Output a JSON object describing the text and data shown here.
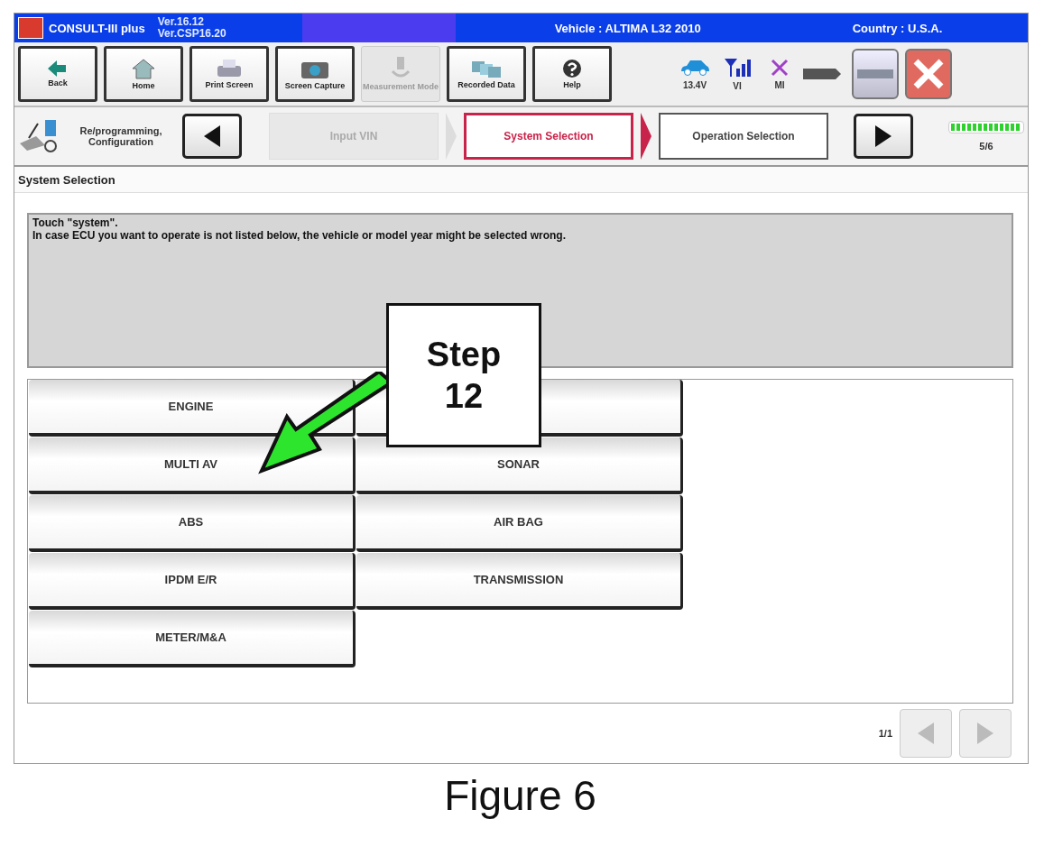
{
  "title_bar": {
    "app_name": "CONSULT-III plus",
    "versions": [
      "Ver.16.12",
      "Ver.CSP16.20"
    ],
    "vehicle": "Vehicle : ALTIMA L32 2010",
    "country": "Country : U.S.A."
  },
  "toolbar": [
    {
      "kind": "back",
      "label": "Back",
      "disabled": false
    },
    {
      "kind": "home",
      "label": "Home",
      "disabled": false
    },
    {
      "kind": "print",
      "label": "Print Screen",
      "disabled": false
    },
    {
      "kind": "camera",
      "label": "Screen Capture",
      "disabled": false
    },
    {
      "kind": "measure",
      "label": "Measurement Mode",
      "disabled": true
    },
    {
      "kind": "recorded",
      "label": "Recorded Data",
      "disabled": false
    },
    {
      "kind": "help",
      "label": "Help",
      "disabled": false
    }
  ],
  "status": [
    {
      "kind": "car",
      "label": "13.4V"
    },
    {
      "kind": "signal",
      "label": "VI"
    },
    {
      "kind": "cross",
      "label": "MI"
    },
    {
      "kind": "battery"
    }
  ],
  "breadcrumb": {
    "mode": "Re/programming, Configuration",
    "steps": [
      {
        "label": "Input VIN",
        "selected": false,
        "disabled": true
      },
      {
        "label": "System Selection",
        "selected": true,
        "disabled": false
      },
      {
        "label": "Operation Selection",
        "selected": false,
        "disabled": false
      }
    ],
    "progress": {
      "level": 1,
      "text": "5/6"
    }
  },
  "section_title": "System Selection",
  "message": [
    "Touch \"system\".",
    "In case ECU you want to operate is not listed below, the vehicle or model year might be selected wrong."
  ],
  "systems": [
    {
      "kind": "system",
      "label": "ENGINE"
    },
    {
      "kind": "covered"
    },
    {
      "kind": "system",
      "label": "MULTI AV"
    },
    {
      "kind": "system",
      "label": "SONAR"
    },
    {
      "kind": "system",
      "label": "ABS"
    },
    {
      "kind": "system",
      "label": "AIR BAG"
    },
    {
      "kind": "system",
      "label": "IPDM E/R"
    },
    {
      "kind": "system",
      "label": "TRANSMISSION"
    },
    {
      "kind": "system",
      "label": "METER/M&A"
    }
  ],
  "pager": {
    "text": "1/1",
    "prev_disabled": true,
    "next_disabled": true
  },
  "callout": {
    "lines": [
      "Step",
      "12"
    ]
  },
  "caption": "Figure 6"
}
